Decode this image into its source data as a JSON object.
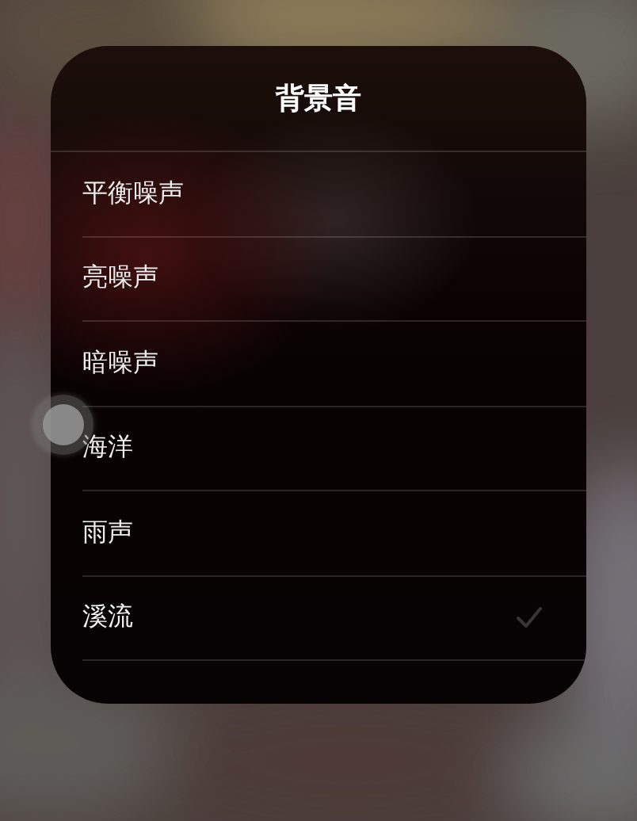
{
  "sheet": {
    "title": "背景音",
    "options": [
      {
        "label": "平衡噪声",
        "selected": false
      },
      {
        "label": "亮噪声",
        "selected": false
      },
      {
        "label": "暗噪声",
        "selected": false
      },
      {
        "label": "海洋",
        "selected": false
      },
      {
        "label": "雨声",
        "selected": false
      },
      {
        "label": "溪流",
        "selected": true
      }
    ]
  }
}
